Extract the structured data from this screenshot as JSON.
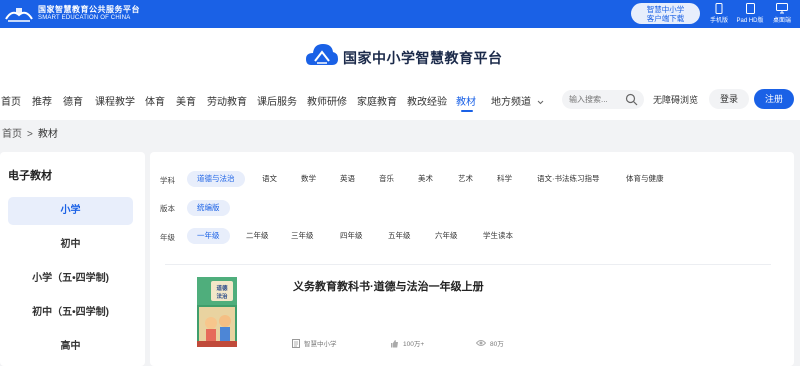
{
  "topbar": {
    "brand_cn": "国家智慧教育公共服务平台",
    "brand_en": "SMART EDUCATION OF CHINA",
    "client_btn_line1": "智慧中小学",
    "client_btn_line2": "客户端下载",
    "devices": [
      {
        "label": "手机版",
        "icon": "phone-icon"
      },
      {
        "label": "Pad HD版",
        "icon": "tablet-icon"
      },
      {
        "label": "桌面端",
        "icon": "desktop-icon"
      }
    ]
  },
  "header": {
    "site_title": "国家中小学智慧教育平台"
  },
  "nav": {
    "items": [
      "首页",
      "推荐",
      "德育",
      "课程教学",
      "体育",
      "美育",
      "劳动教育",
      "课后服务",
      "教师研修",
      "家庭教育",
      "教改经验",
      "教材",
      "地方频道"
    ],
    "active": "教材",
    "search_placeholder": "输入搜索...",
    "accessibility": "无障碍浏览",
    "login": "登录",
    "register": "注册"
  },
  "breadcrumb": {
    "home": "首页",
    "separator": ">",
    "current": "教材"
  },
  "sidebar": {
    "title": "电子教材",
    "stages": [
      "小学",
      "初中",
      "小学（五•四学制)",
      "初中（五•四学制)",
      "高中"
    ],
    "active": "小学"
  },
  "filters": {
    "subject_label": "学科",
    "subjects": [
      "道德与法治",
      "语文",
      "数学",
      "英语",
      "音乐",
      "美术",
      "艺术",
      "科学",
      "语文·书法练习指导",
      "体育与健康"
    ],
    "subject_active": "道德与法治",
    "edition_label": "版本",
    "editions": [
      "统编版"
    ],
    "edition_active": "统编版",
    "grade_label": "年级",
    "grades": [
      "一年级",
      "二年级",
      "三年级",
      "四年级",
      "五年级",
      "六年级",
      "学生读本"
    ],
    "grade_active": "一年级"
  },
  "book": {
    "title": "义务教育教科书·道德与法治一年级上册",
    "publisher": "智慧中小学",
    "likes": "100万+",
    "views": "80万",
    "cover_title": "道德与法治"
  },
  "colors": {
    "brand_blue": "#1a61e6",
    "active_bg": "#e8eefb",
    "page_bg": "#f2f3f5"
  }
}
